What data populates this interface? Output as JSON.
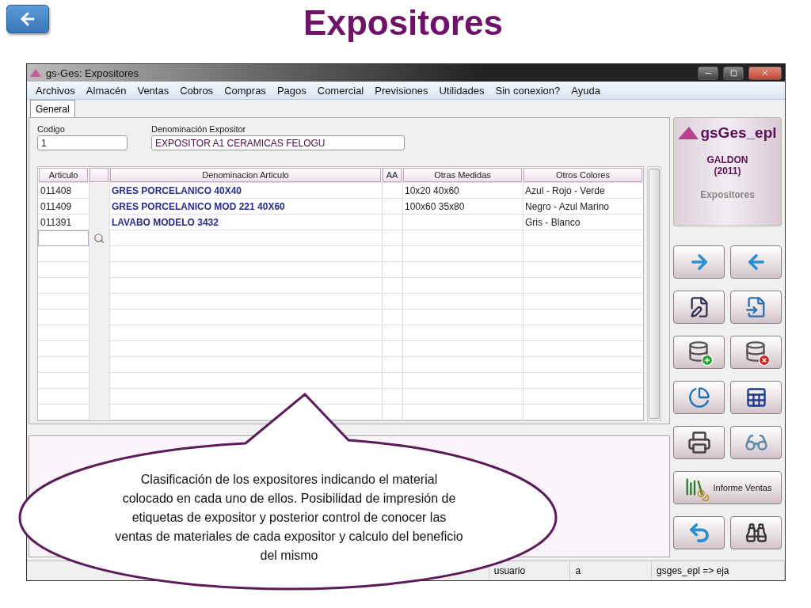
{
  "slide": {
    "title": "Expositores"
  },
  "window": {
    "title": "gs-Ges: Expositores"
  },
  "menu": [
    "Archivos",
    "Almacén",
    "Ventas",
    "Cobros",
    "Compras",
    "Pagos",
    "Comercial",
    "Previsiones",
    "Utilidades",
    "Sin conexion?",
    "Ayuda"
  ],
  "tabs": [
    {
      "label": "General",
      "selected": true
    }
  ],
  "fields": [
    {
      "label": "Codigo",
      "value": "1"
    },
    {
      "label": "Denominación Expositor",
      "value": "EXPOSITOR A1 CERAMICAS FELOGU"
    }
  ],
  "table": {
    "columns": [
      "Articulo",
      "",
      "Denominacion Articulo",
      "AA",
      "Otras Medidas",
      "Otros Colores"
    ],
    "rows": [
      {
        "articulo": "011408",
        "denominacion": "GRES PORCELANICO 40X40",
        "medidas": "10x20 40x60",
        "colores": "Azul - Rojo - Verde"
      },
      {
        "articulo": "011409",
        "denominacion": "GRES PORCELANICO MOD 221 40X60",
        "medidas": "100x60 35x80",
        "colores": "Negro - Azul Marino"
      },
      {
        "articulo": "011391",
        "denominacion": "LAVABO MODELO 3432",
        "colores": "Gris - Blanco"
      }
    ]
  },
  "brand": {
    "name": "gsGes_epl",
    "company": "GALDON",
    "year": "(2011)",
    "module": "Expositores"
  },
  "buttons": [
    {
      "kind": "forward"
    },
    {
      "kind": "back"
    },
    {
      "kind": "edit-doc"
    },
    {
      "kind": "revert-doc"
    },
    {
      "kind": "db-add"
    },
    {
      "kind": "db-delete"
    },
    {
      "kind": "chart-doc"
    },
    {
      "kind": "sheet-edit"
    },
    {
      "kind": "print"
    },
    {
      "kind": "glasses"
    },
    {
      "kind": "report",
      "label": "Informe Ventas"
    },
    {
      "kind": "undo"
    },
    {
      "kind": "binoculars"
    }
  ],
  "callout": {
    "text": "Clasificación de los expositores indicando el material colocado en cada uno de ellos. Posibilidad de impresión de etiquetas de expositor y posterior control de conocer las ventas de materiales de cada expositor y calculo del beneficio del mismo"
  },
  "status_bar": [
    "usuario",
    "a",
    "gsges_epl => eja"
  ]
}
